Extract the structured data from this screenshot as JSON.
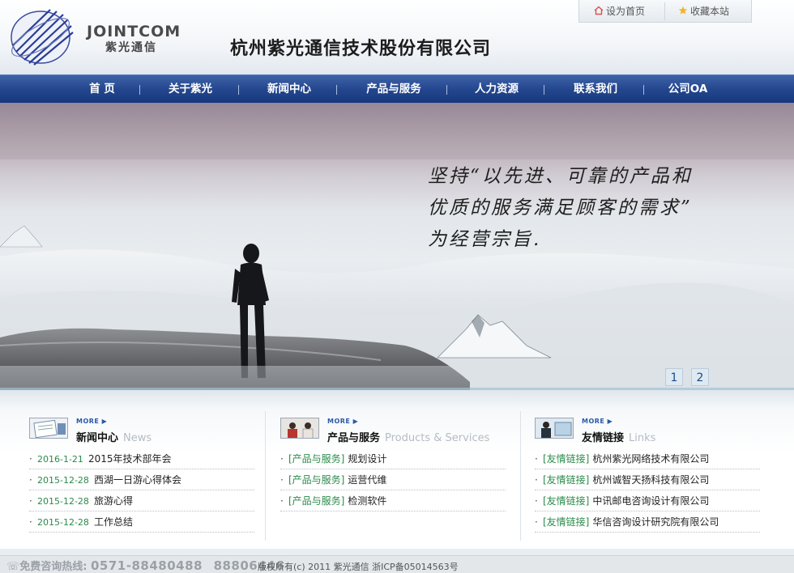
{
  "header": {
    "logo_en": "JOINTCOM",
    "logo_cn": "紫光通信",
    "company_name": "杭州紫光通信技术股份有限公司",
    "top_links": {
      "set_home": "设为首页",
      "bookmark": "收藏本站"
    }
  },
  "nav": {
    "items": [
      "首 页",
      "关于紫光",
      "新闻中心",
      "产品与服务",
      "人力资源",
      "联系我们",
      "公司OA"
    ]
  },
  "banner": {
    "slogan_line1": "坚持“以先进、可靠的产品和",
    "slogan_line2": "优质的服务满足顾客的需求”",
    "slogan_line3": "为经营宗旨.",
    "pages": [
      "1",
      "2"
    ]
  },
  "news": {
    "more": "MORE ▶",
    "title": "新闻中心",
    "title_en": "News",
    "items": [
      {
        "date": "2016-1-21",
        "text": "2015年技术部年会"
      },
      {
        "date": "2015-12-28",
        "text": "西湖一日游心得体会"
      },
      {
        "date": "2015-12-28",
        "text": "旅游心得"
      },
      {
        "date": "2015-12-28",
        "text": "工作总结"
      }
    ]
  },
  "products": {
    "more": "MORE ▶",
    "title": "产品与服务",
    "title_en": "Products & Services",
    "items": [
      {
        "tag": "[产品与服务]",
        "text": "规划设计"
      },
      {
        "tag": "[产品与服务]",
        "text": "运营代维"
      },
      {
        "tag": "[产品与服务]",
        "text": "检测软件"
      }
    ]
  },
  "links": {
    "more": "MORE ▶",
    "title": "友情链接",
    "title_en": "Links",
    "items": [
      {
        "tag": "[友情链接]",
        "text": "杭州紫光网络技术有限公司"
      },
      {
        "tag": "[友情链接]",
        "text": "杭州诚智天扬科技有限公司"
      },
      {
        "tag": "[友情链接]",
        "text": "中讯邮电咨询设计有限公司"
      },
      {
        "tag": "[友情链接]",
        "text": "华信咨询设计研究院有限公司"
      }
    ]
  },
  "footer": {
    "hotline_label": "☏免费咨询热线:",
    "hotline_1": "0571-88480488",
    "hotline_2": "88806446",
    "copyright": "版权所有(c) 2011 紫光通信 浙ICP备05014563号"
  },
  "colors": {
    "nav_blue": "#24478f",
    "green_text": "#2a8a4a"
  }
}
